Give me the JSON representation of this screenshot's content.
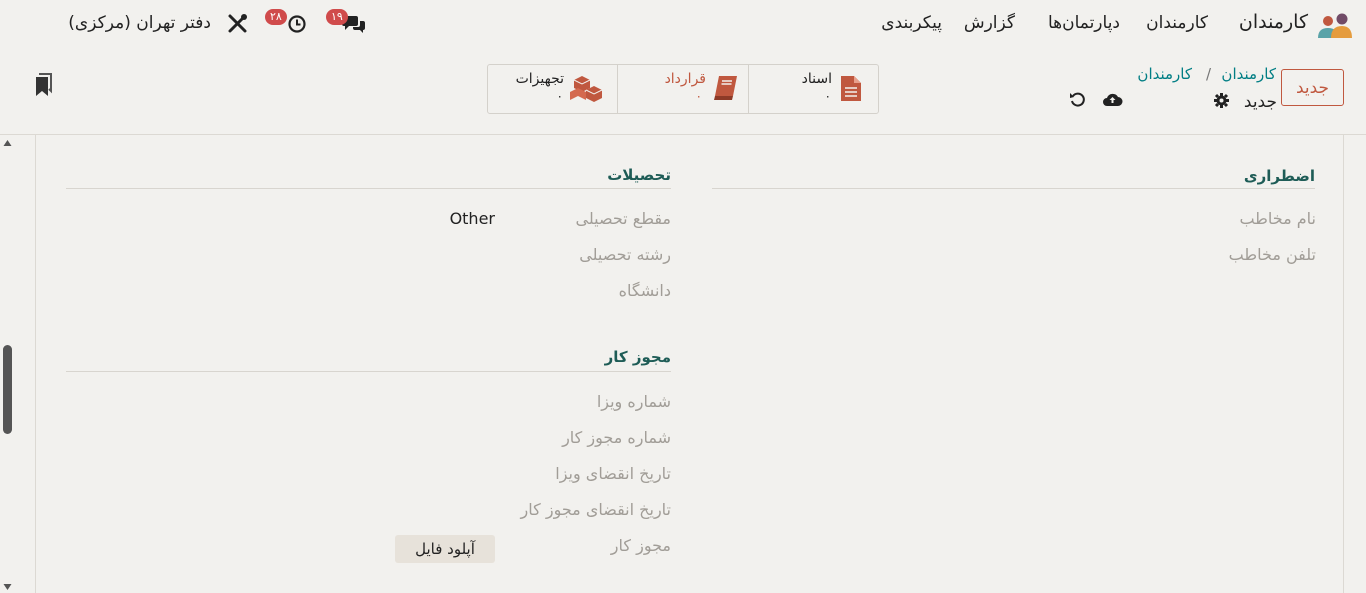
{
  "app": {
    "title": "کارمندان"
  },
  "nav": {
    "menu": [
      "کارمندان",
      "دپارتمان‌ها",
      "گزارش",
      "پیکربندی"
    ],
    "company": "دفتر تهران (مرکزی)",
    "messages_badge": "۱۹",
    "activity_badge": "۲۸"
  },
  "control": {
    "new_button": "جدید",
    "breadcrumb_link_1": "کارمندان",
    "breadcrumb_separator": "/",
    "breadcrumb_link_2": "کارمندان",
    "record_name": "جدید"
  },
  "smart_buttons": [
    {
      "label": "اسناد",
      "count": "۰",
      "icon": "document-icon"
    },
    {
      "label": "قرارداد",
      "count": "۰",
      "icon": "book-icon"
    },
    {
      "label": "تجهیزات",
      "count": "۰",
      "icon": "boxes-icon"
    }
  ],
  "emergency": {
    "title": "اضطراری",
    "fields": [
      "نام مخاطب",
      "تلفن مخاطب"
    ]
  },
  "education": {
    "title": "تحصیلات",
    "fields": [
      {
        "label": "مقطع تحصیلی",
        "value": "Other"
      },
      {
        "label": "رشته تحصیلی",
        "value": ""
      },
      {
        "label": "دانشگاه",
        "value": ""
      }
    ]
  },
  "work_permit": {
    "title": "مجوز کار",
    "fields": [
      "شماره ویزا",
      "شماره مجوز کار",
      "تاریخ انقضای ویزا",
      "تاریخ انقضای مجوز کار",
      "مجوز کار"
    ],
    "upload_label": "آپلود فایل"
  },
  "colors": {
    "accent": "#017e84",
    "primary": "#c0583f",
    "badge": "#d04b4b",
    "section_title": "#1e5c56",
    "muted_label": "#a19d97"
  }
}
